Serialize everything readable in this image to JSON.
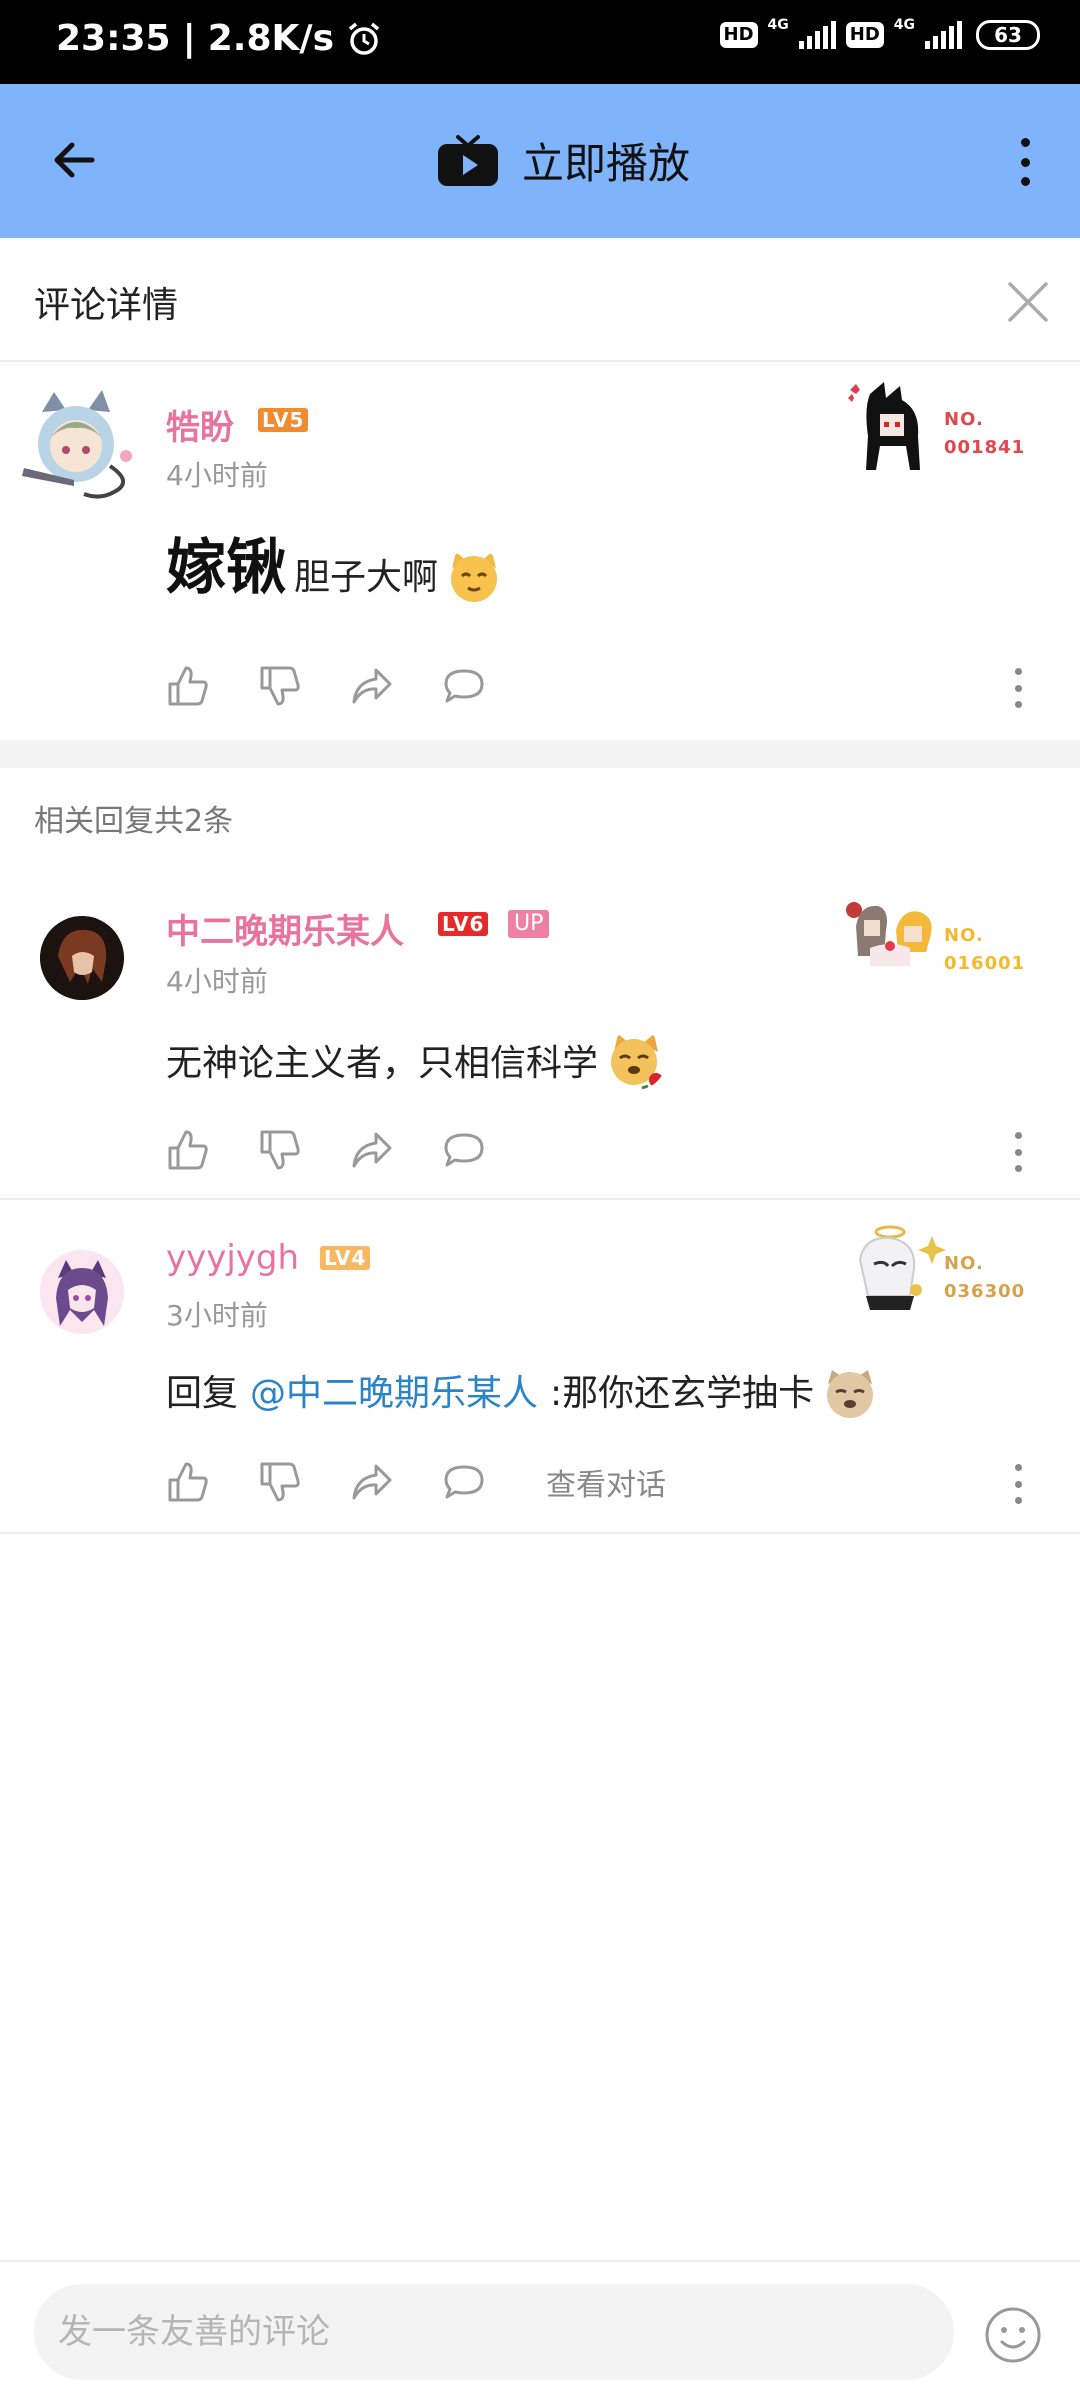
{
  "status_bar": {
    "time": "23:35",
    "net_speed": "2.8K/s",
    "hd1": "HD",
    "net1": "4G",
    "hd2": "HD",
    "net2": "4G",
    "battery": "63"
  },
  "app_bar": {
    "title": "立即播放"
  },
  "detail": {
    "title": "评论详情"
  },
  "main_comment": {
    "username": "牿盼",
    "level": "LV5",
    "time": "4小时前",
    "text_big": "嫁锹",
    "text": "胆子大啊",
    "fan_no_label": "NO.",
    "fan_no": "001841"
  },
  "replies_heading": "相关回复共2条",
  "replies": [
    {
      "username": "中二晚期乐某人",
      "level": "LV6",
      "up_badge": "UP",
      "time": "4小时前",
      "text": "无神论主义者，只相信科学",
      "fan_no_label": "NO.",
      "fan_no": "016001"
    },
    {
      "username": "yyyjygh",
      "level": "LV4",
      "time": "3小时前",
      "reply_prefix": "回复",
      "mention": "@中二晚期乐某人",
      "text": ":那你还玄学抽卡",
      "view_conversation": "查看对话",
      "fan_no_label": "NO.",
      "fan_no": "036300"
    }
  ],
  "input": {
    "placeholder": "发一条友善的评论"
  },
  "colors": {
    "app_bar": "#7fb4fb",
    "username": "#e8749d",
    "mention": "#2a84c7",
    "lv5": "#f28a2f",
    "lv6": "#e62a2a",
    "lv4": "#f5b865"
  }
}
